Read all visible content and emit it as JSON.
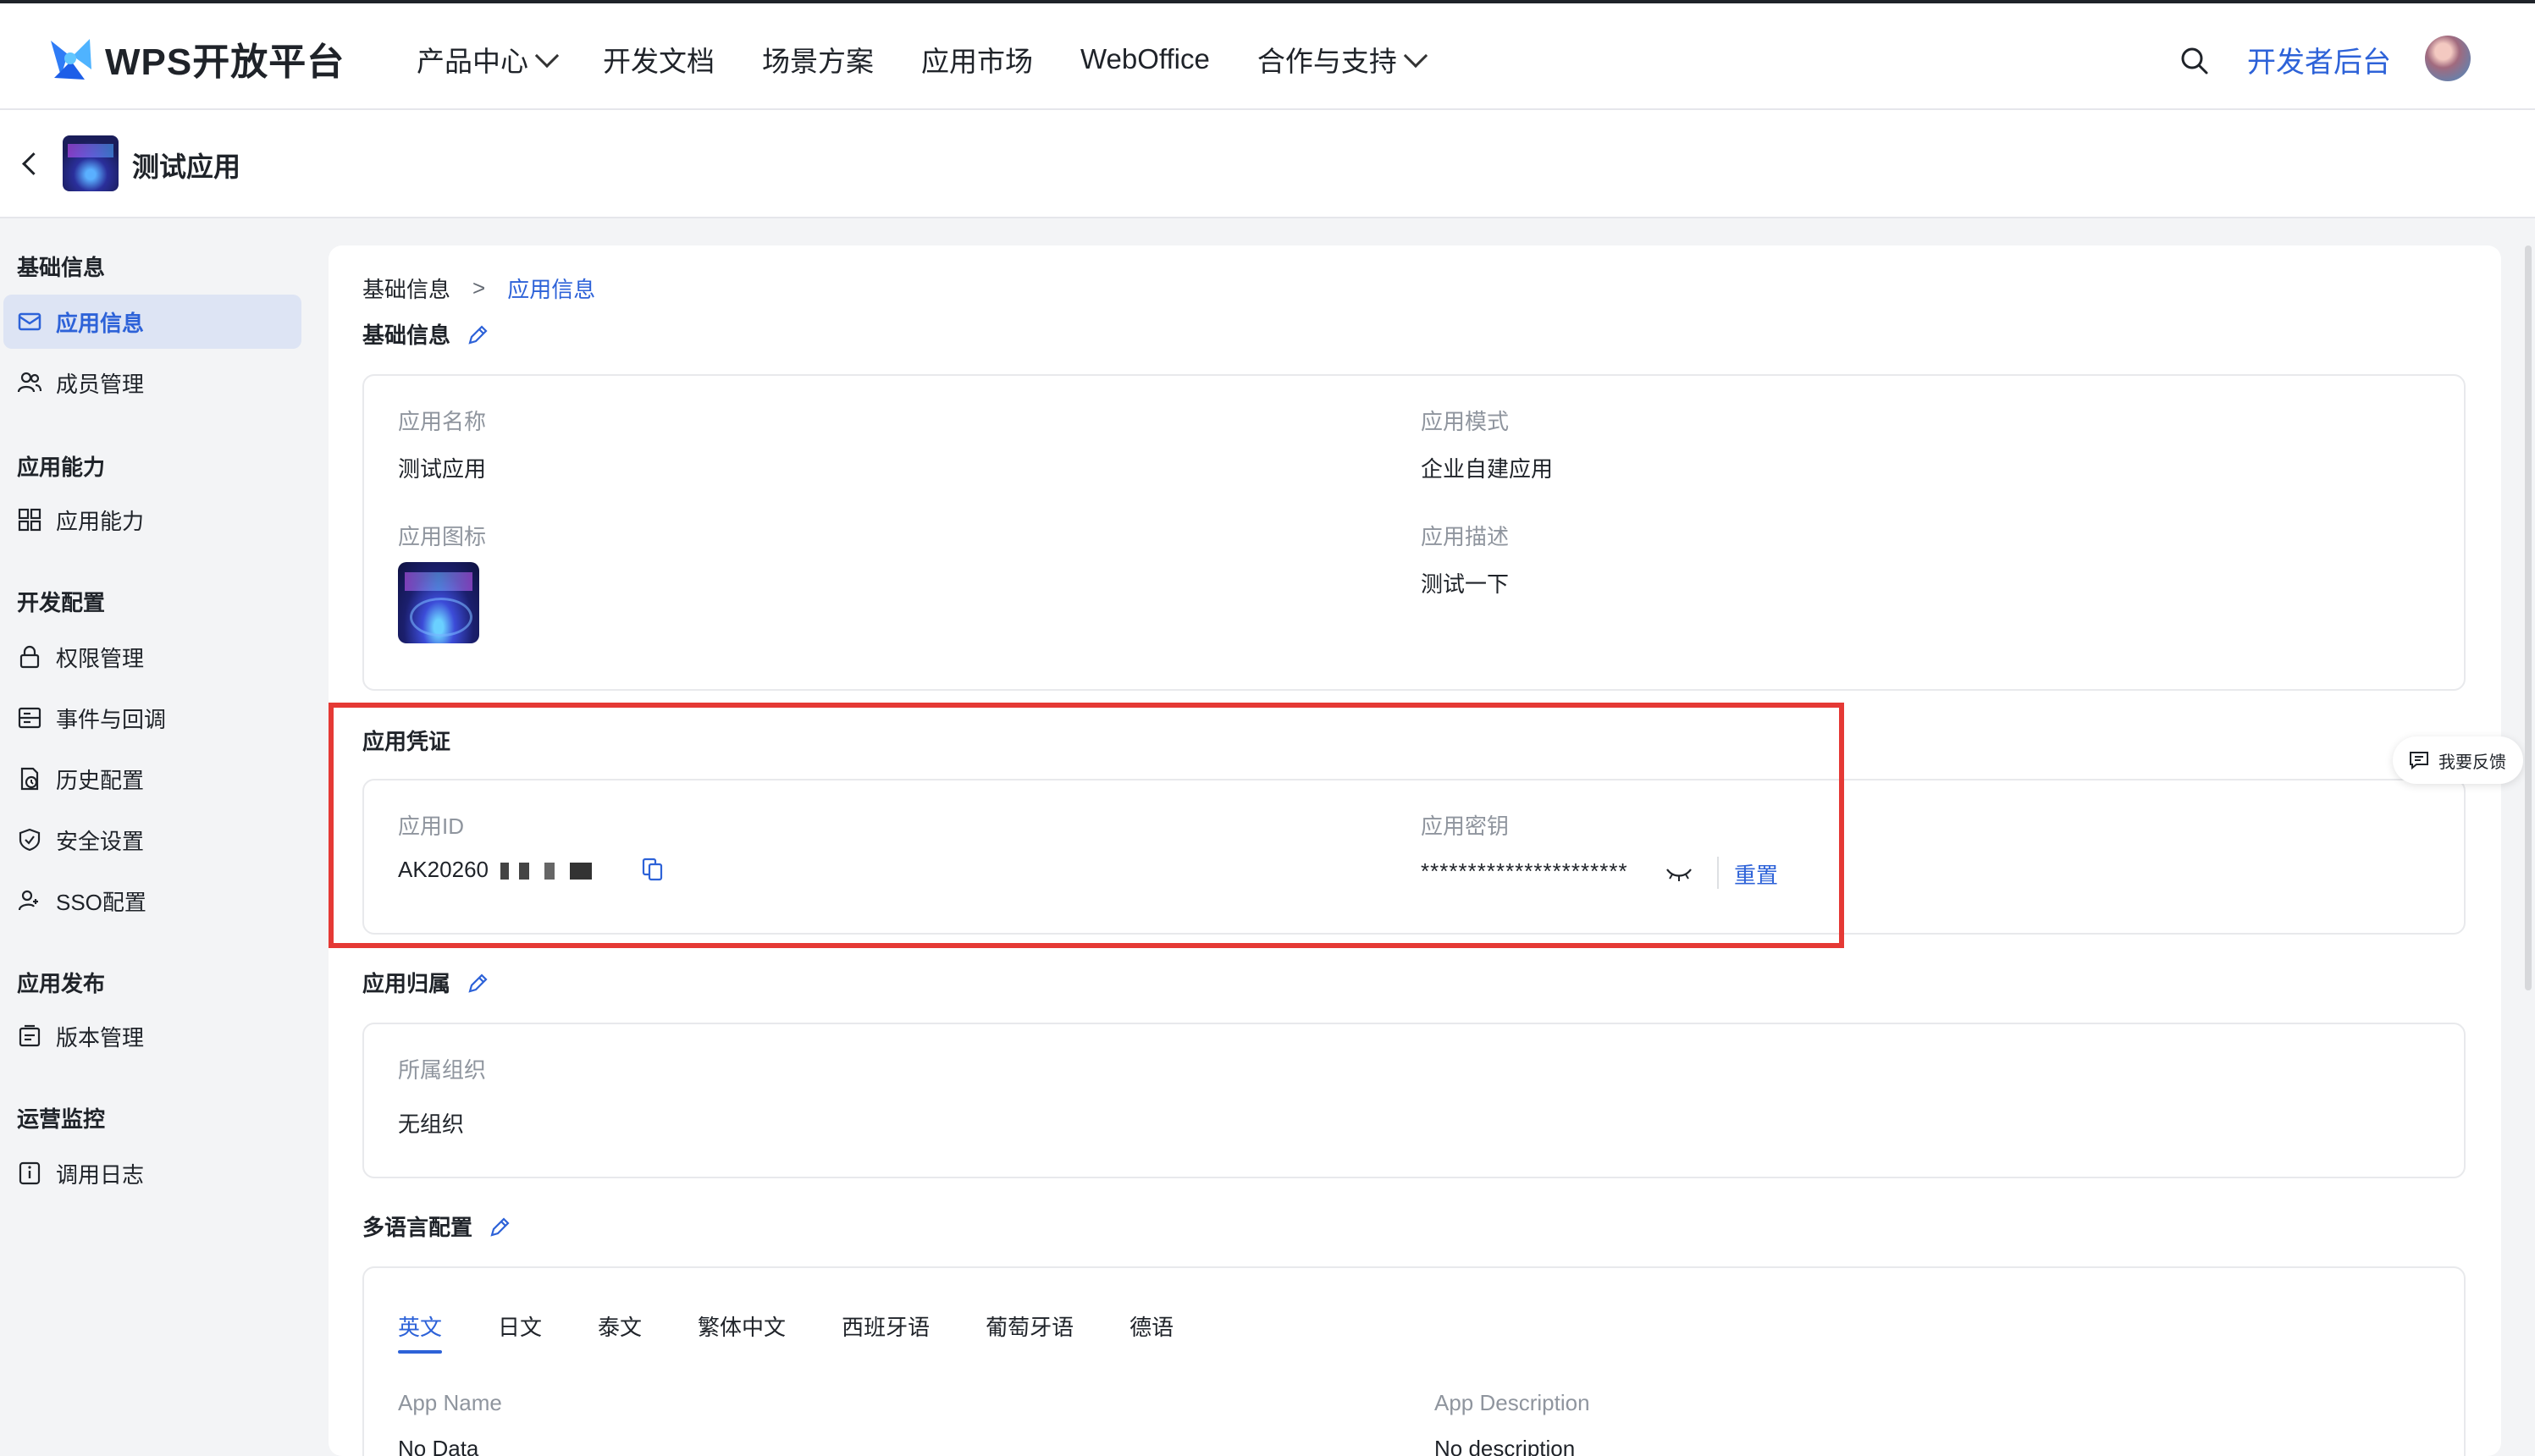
{
  "topnav": {
    "brand": "WPS开放平台",
    "items": [
      {
        "label": "产品中心",
        "has_dropdown": true
      },
      {
        "label": "开发文档",
        "has_dropdown": false
      },
      {
        "label": "场景方案",
        "has_dropdown": false
      },
      {
        "label": "应用市场",
        "has_dropdown": false
      },
      {
        "label": "WebOffice",
        "has_dropdown": false
      },
      {
        "label": "合作与支持",
        "has_dropdown": true
      }
    ],
    "dev_console": "开发者后台",
    "search_icon": "search-icon"
  },
  "app": {
    "title": "测试应用"
  },
  "sidebar": {
    "groups": [
      {
        "title": "基础信息",
        "items": [
          {
            "label": "应用信息",
            "icon": "mail-icon",
            "active": true
          },
          {
            "label": "成员管理",
            "icon": "users-icon",
            "active": false
          }
        ]
      },
      {
        "title": "应用能力",
        "items": [
          {
            "label": "应用能力",
            "icon": "grid-icon",
            "active": false
          }
        ]
      },
      {
        "title": "开发配置",
        "items": [
          {
            "label": "权限管理",
            "icon": "lock-icon",
            "active": false
          },
          {
            "label": "事件与回调",
            "icon": "event-icon",
            "active": false
          },
          {
            "label": "历史配置",
            "icon": "history-icon",
            "active": false
          },
          {
            "label": "安全设置",
            "icon": "shield-icon",
            "active": false
          },
          {
            "label": "SSO配置",
            "icon": "user-key-icon",
            "active": false
          }
        ]
      },
      {
        "title": "应用发布",
        "items": [
          {
            "label": "版本管理",
            "icon": "version-icon",
            "active": false
          }
        ]
      },
      {
        "title": "运营监控",
        "items": [
          {
            "label": "调用日志",
            "icon": "log-icon",
            "active": false
          }
        ]
      }
    ]
  },
  "breadcrumb": {
    "parent": "基础信息",
    "separator": ">",
    "current": "应用信息"
  },
  "basic": {
    "title": "基础信息",
    "app_name_label": "应用名称",
    "app_name": "测试应用",
    "mode_label": "应用模式",
    "mode": "企业自建应用",
    "icon_label": "应用图标",
    "desc_label": "应用描述",
    "desc": "测试一下"
  },
  "credentials": {
    "title": "应用凭证",
    "id_label": "应用ID",
    "id_value": "AK20260",
    "secret_label": "应用密钥",
    "secret_value": "**********************",
    "reset_label": "重置"
  },
  "ownership": {
    "title": "应用归属",
    "org_label": "所属组织",
    "org_value": "无组织"
  },
  "i18n": {
    "title": "多语言配置",
    "tabs": [
      "英文",
      "日文",
      "泰文",
      "繁体中文",
      "西班牙语",
      "葡萄牙语",
      "德语"
    ],
    "active_tab": 0,
    "app_name_label": "App Name",
    "app_name_value": "No Data",
    "app_desc_label": "App Description",
    "app_desc_value": "No description"
  },
  "feedback": {
    "label": "我要反馈"
  },
  "colors": {
    "accent": "#2d62d8",
    "highlight": "#e53935",
    "active_bg": "#dde4f4"
  }
}
